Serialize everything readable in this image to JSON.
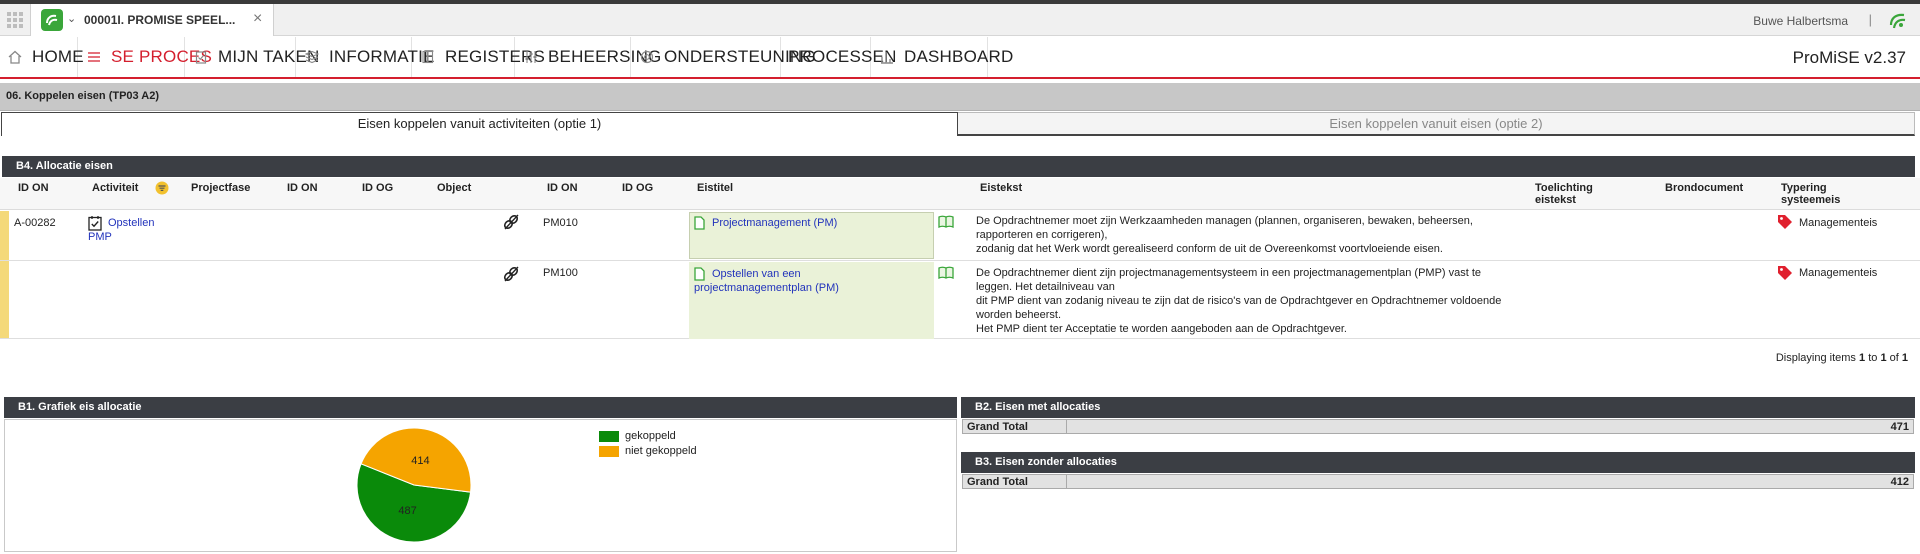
{
  "tabbar": {
    "app_title": "00001I. PROMISE SPEEL...",
    "close": "×",
    "user_name": "Buwe Halbertsma",
    "separator": "|"
  },
  "nav": {
    "items": [
      {
        "label": "HOME",
        "icon": "home-icon"
      },
      {
        "label": "SE PROCES",
        "icon": "list-icon"
      },
      {
        "label": "MIJN TAKEN",
        "icon": "clipboard-icon"
      },
      {
        "label": "INFORMATIE",
        "icon": "layers-icon"
      },
      {
        "label": "REGISTERS",
        "icon": "book-icon"
      },
      {
        "label": "BEHEERSING",
        "icon": "sliders-icon"
      },
      {
        "label": "ONDERSTEUNING",
        "icon": "lifebuoy-icon"
      },
      {
        "label": "PROCESSEN",
        "icon": ""
      },
      {
        "label": "DASHBOARD",
        "icon": "bar-chart-icon"
      }
    ],
    "active": "SE PROCES",
    "version": "ProMiSE v2.37"
  },
  "page": {
    "section_title": "06. Koppelen eisen (TP03 A2)",
    "subtabs": [
      "Eisen koppelen vanuit activiteiten (optie 1)",
      "Eisen koppelen vanuit eisen (optie 2)"
    ]
  },
  "b4": {
    "title": "B4. Allocatie eisen",
    "columns": [
      "ID ON",
      "Activiteit",
      "Projectfase",
      "ID ON",
      "ID OG",
      "Object",
      "ID ON",
      "ID OG",
      "Eistitel",
      "Eistekst",
      "Toelichting eistekst",
      "Brondocument",
      "Typering systeemeis"
    ],
    "activity": {
      "id_on": "A-00282",
      "name": "Opstellen PMP"
    },
    "rows": [
      {
        "id_on": "PM010",
        "title": "Projectmanagement (PM)",
        "text_lines": [
          "De Opdrachtnemer moet zijn Werkzaamheden managen (plannen, organiseren, bewaken, beheersen,",
          "rapporteren en corrigeren),",
          "zodanig dat het Werk wordt gerealiseerd conform de uit de Overeenkomst voortvloeiende eisen."
        ],
        "type": "Managementeis"
      },
      {
        "id_on": "PM100",
        "title": "Opstellen van een projectmanagementplan (PM)",
        "text_lines": [
          "De Opdrachtnemer dient zijn projectmanagementsysteem in een projectmanagementplan (PMP) vast te",
          "leggen. Het detailniveau van",
          "dit PMP dient van zodanig niveau te zijn dat de risico's van de Opdrachtgever en Opdrachtnemer voldoende",
          "worden beheerst.",
          "Het PMP dient ter Acceptatie te worden aangeboden aan de Opdrachtgever."
        ],
        "type": "Managementeis"
      }
    ],
    "paginator": {
      "prefix": "Displaying items",
      "from": "1",
      "to_word": "to",
      "to": "1",
      "of_word": "of",
      "total": "1"
    }
  },
  "b1": {
    "title": "B1. Grafiek eis allocatie",
    "chart_data": {
      "type": "pie",
      "title": "",
      "slices": [
        {
          "name": "gekoppeld",
          "value": 487,
          "color": "#0a8a0a"
        },
        {
          "name": "niet gekoppeld",
          "value": 414,
          "color": "#f5a400"
        }
      ],
      "legend": "right"
    }
  },
  "b2": {
    "title": "B2. Eisen met allocaties",
    "total_label": "Grand Total",
    "total_value": "471"
  },
  "b3": {
    "title": "B3. Eisen zonder allocaties",
    "total_label": "Grand Total",
    "total_value": "412"
  },
  "colors": {
    "accent": "#d41f2e",
    "header_dark": "#3b3e44",
    "link": "#2233bb"
  }
}
